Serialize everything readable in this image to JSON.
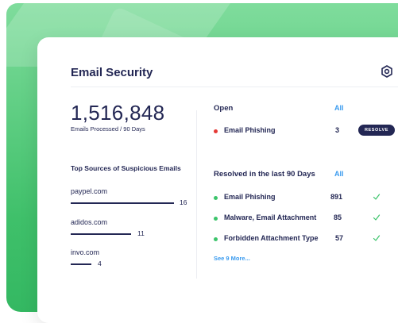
{
  "card": {
    "title": "Email Security"
  },
  "stats": {
    "emails_processed": "1,516,848",
    "caption": "Emails Processed / 90 Days"
  },
  "sources": {
    "title": "Top Sources of Suspicious Emails",
    "items": [
      {
        "name": "paypel.com",
        "count": "16",
        "value": 16
      },
      {
        "name": "adidos.com",
        "count": "11",
        "value": 11
      },
      {
        "name": "invo.com",
        "count": "4",
        "value": 4
      }
    ]
  },
  "open": {
    "title": "Open",
    "all_label": "All",
    "items": [
      {
        "label": "Email Phishing",
        "count": "3",
        "status_color": "#e53935",
        "action": "RESOLVE"
      }
    ]
  },
  "resolved": {
    "title": "Resolved in the last 90 Days",
    "all_label": "All",
    "items": [
      {
        "label": "Email Phishing",
        "count": "891",
        "status_color": "#3cc46b"
      },
      {
        "label": "Malware, Email Attachment",
        "count": "85",
        "status_color": "#3cc46b"
      },
      {
        "label": "Forbidden Attachment Type",
        "count": "57",
        "status_color": "#3cc46b"
      }
    ],
    "see_more": "See 9 More..."
  },
  "colors": {
    "navy": "#232754",
    "link_blue": "#3a9bef",
    "green": "#3cc46b",
    "red": "#e53935"
  },
  "icons": {
    "settings": "hexagon-settings-icon",
    "check": "check-icon"
  }
}
